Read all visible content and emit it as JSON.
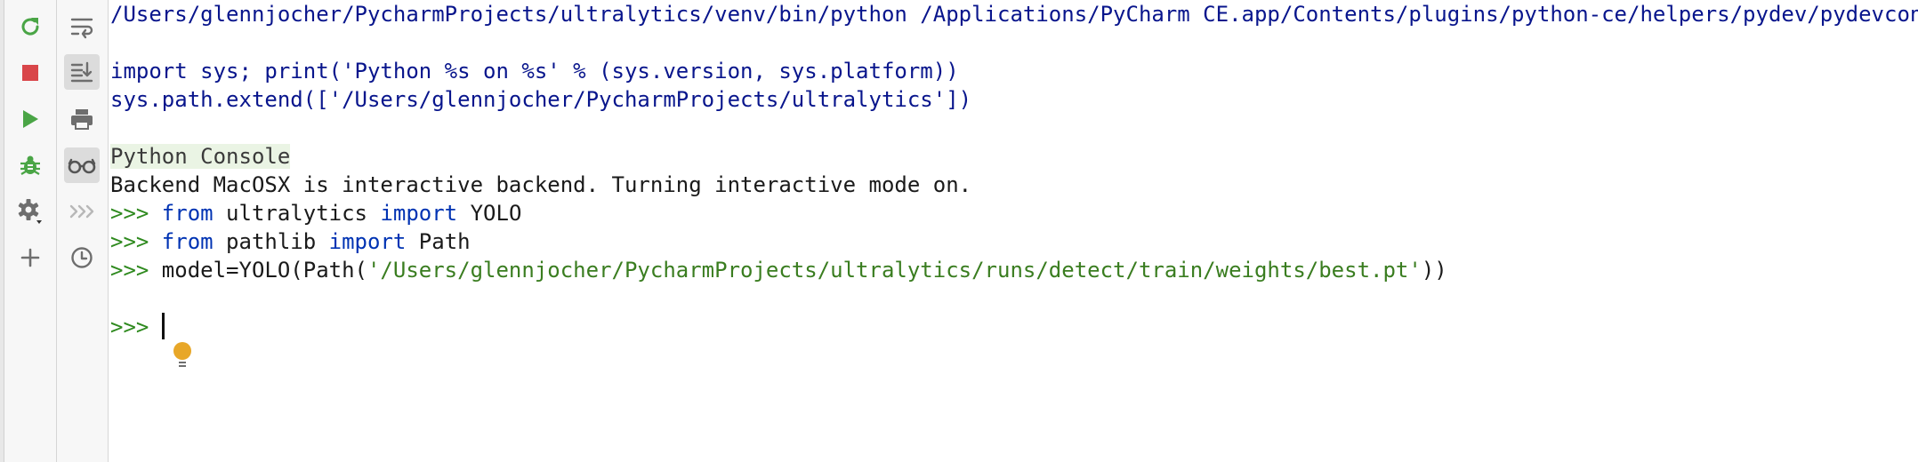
{
  "toolbar_left": [
    {
      "name": "rerun-icon",
      "tooltip": "Rerun"
    },
    {
      "name": "stop-icon",
      "tooltip": "Stop"
    },
    {
      "name": "run-icon",
      "tooltip": "Execute"
    },
    {
      "name": "debug-icon",
      "tooltip": "Debug"
    },
    {
      "name": "settings-icon",
      "tooltip": "Settings"
    },
    {
      "name": "add-icon",
      "tooltip": "New Console"
    }
  ],
  "toolbar_right": [
    {
      "name": "soft-wrap-icon"
    },
    {
      "name": "scroll-to-end-icon"
    },
    {
      "name": "print-icon"
    },
    {
      "name": "show-variables-icon"
    },
    {
      "name": "execute-queue-icon"
    },
    {
      "name": "history-icon"
    }
  ],
  "console": {
    "command_line": "/Users/glennjocher/PycharmProjects/ultralytics/venv/bin/python /Applications/PyCharm CE.app/Contents/plugins/python-ce/helpers/pydev/pydevconsole",
    "init_line1": "import sys; print('Python %s on %s' % (sys.version, sys.platform))",
    "init_line2": "sys.path.extend(['/Users/glennjocher/PycharmProjects/ultralytics'])",
    "header": "Python Console",
    "backend_msg": "Backend MacOSX is interactive backend. Turning interactive mode on.",
    "prompt": ">>> ",
    "cmd1": {
      "kw1": "from",
      "mid": " ultralytics ",
      "kw2": "import",
      "rest": " YOLO"
    },
    "cmd2": {
      "kw1": "from",
      "mid": " pathlib ",
      "kw2": "import",
      "rest": " Path"
    },
    "cmd3": {
      "pre": "model=YOLO(Path(",
      "str": "'/Users/glennjocher/PycharmProjects/ultralytics/runs/detect/train/weights/best.pt'",
      "post": "))"
    }
  },
  "colors": {
    "keyword": "#0033b3",
    "prompt": "#2f8a1f",
    "string": "#3a7d20",
    "path_text": "#08158c"
  }
}
